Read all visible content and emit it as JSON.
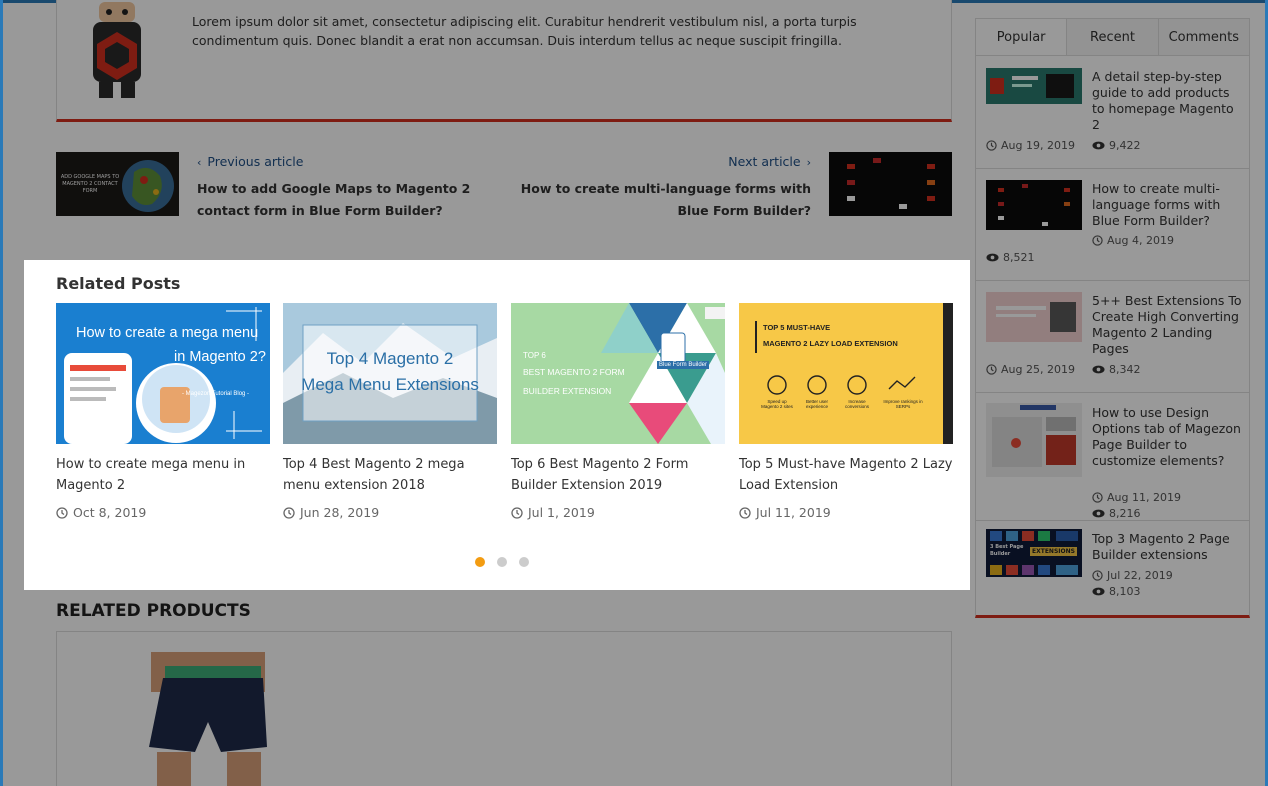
{
  "author": {
    "bio": "Lorem ipsum dolor sit amet, consectetur adipiscing elit. Curabitur hendrerit vestibulum nisl, a porta turpis condimentum quis. Donec blandit a erat non accumsan. Duis interdum tellus ac neque suscipit fringilla."
  },
  "navigation": {
    "prev_label": "Previous article",
    "prev_title": "How to add Google Maps to Magento 2 contact form in Blue Form Builder?",
    "prev_thumb_text": "ADD GOOGLE MAPS TO MAGENTO 2 CONTACT FORM",
    "next_label": "Next article",
    "next_title": "How to create multi-language forms with Blue Form Builder?"
  },
  "related_posts": {
    "heading": "Related Posts",
    "items": [
      {
        "title": "How to create mega menu in Magento 2",
        "date": "Oct 8, 2019",
        "img_line1": "How to create a mega menu",
        "img_line2": "in Magento 2?",
        "img_caption": "- Magezon Tutorial Blog -"
      },
      {
        "title": "Top 4 Best Magento 2 mega menu extension 2018",
        "date": "Jun 28, 2019",
        "img_line1": "Top 4 Magento 2",
        "img_line2": "Mega Menu Extensions"
      },
      {
        "title": "Top 6 Best Magento 2 Form Builder Extension 2019",
        "date": "Jul 1, 2019",
        "img_line1": "TOP 6",
        "img_line2": "BEST MAGENTO 2 FORM",
        "img_line3": "BUILDER EXTENSION",
        "img_tag": "Blue Form Builder"
      },
      {
        "title": "Top 5 Must-have Magento 2 Lazy Load Extension",
        "date": "Jul 11, 2019",
        "img_line1": "TOP 5 MUST-HAVE",
        "img_line2": "MAGENTO 2 LAZY LOAD EXTENSION",
        "img_features": [
          "Speed up Magento 2 sites",
          "Better user experience",
          "Increase conversions",
          "Improve rankings in SERPs"
        ]
      }
    ],
    "dots": 3,
    "active_dot": 0
  },
  "related_products": {
    "heading": "RELATED PRODUCTS"
  },
  "sidebar": {
    "tabs": [
      "Popular",
      "Recent",
      "Comments"
    ],
    "active_tab": "Popular",
    "items": [
      {
        "title": "A detail step-by-step guide to add products to homepage Magento 2",
        "date": "Aug 19, 2019",
        "views": "9,422"
      },
      {
        "title": "How to create multi-language forms with Blue Form Builder?",
        "date": "Aug 4, 2019",
        "views": "8,521"
      },
      {
        "title": "5++ Best Extensions To Create High Converting Magento 2 Landing Pages",
        "date": "Aug 25, 2019",
        "views": "8,342"
      },
      {
        "title": "How to use Design Options tab of Magezon Page Builder to customize elements?",
        "date": "Aug 11, 2019",
        "views": "8,216"
      },
      {
        "title": "Top 3 Magento 2 Page Builder extensions",
        "date": "Jul 22, 2019",
        "views": "8,103",
        "thumb_text": "3 Best Page Builder",
        "thumb_badge": "EXTENSIONS"
      }
    ]
  },
  "colors": {
    "accent_red": "#d3301f",
    "link_blue": "#1f4f86",
    "dot_active": "#f39c12"
  }
}
